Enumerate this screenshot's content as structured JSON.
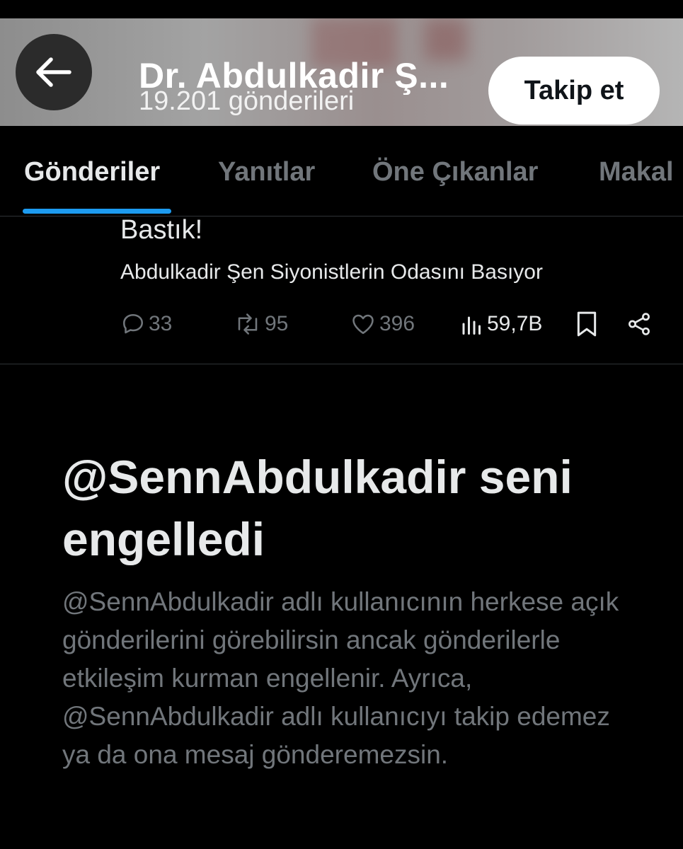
{
  "header": {
    "title": "Dr. Abdulkadir Ş...",
    "post_count": "19.201 gönderileri",
    "follow_label": "Takip et"
  },
  "tabs": [
    {
      "label": "Gönderiler",
      "active": true
    },
    {
      "label": "Yanıtlar",
      "active": false
    },
    {
      "label": "Öne Çıkanlar",
      "active": false
    },
    {
      "label": "Makal",
      "active": false
    }
  ],
  "post": {
    "text": "Bastık!",
    "card_title": "Abdulkadir Şen Siyonistlerin Odasını Basıyor",
    "replies": "33",
    "reposts": "95",
    "likes": "396",
    "views": "59,7B"
  },
  "blocked": {
    "title": "@SennAbdulkadir seni engelledi",
    "description": "@SennAbdulkadir adlı kullanıcının herkese açık gönderilerini görebilirsin ancak gönderilerle etkileşim kurman engellenir. Ayrıca, @SennAbdulkadir adlı kullanıcıyı takip edemez ya da ona mesaj gönderemezsin."
  },
  "colors": {
    "background": "#000000",
    "accent": "#1d9bf0",
    "text_primary": "#e7e9ea",
    "text_secondary": "#71767b"
  },
  "icons": [
    "arrow-left-icon",
    "reply-icon",
    "repost-icon",
    "like-icon",
    "views-icon",
    "bookmark-icon",
    "share-icon"
  ]
}
